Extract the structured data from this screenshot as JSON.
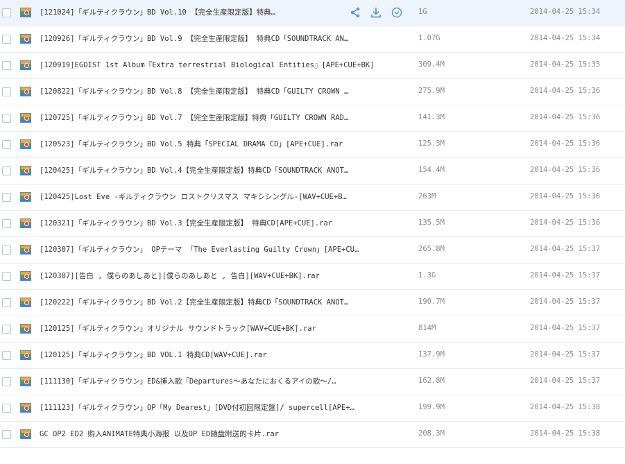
{
  "files": [
    {
      "name": "[121024]「ギルティクラウン」BD Vol.10 【完全生産限定版】特典…",
      "size": "1G",
      "time": "2014-04-25 15:34"
    },
    {
      "name": "[120926]「ギルティクラウン」BD Vol.9 【完全生産限定版】 特典CD「SOUNDTRACK AN…",
      "size": "1.07G",
      "time": "2014-04-25 15:34"
    },
    {
      "name": "[120919]EGOIST 1st Album『Extra terrestrial Biological Entities』[APE+CUE+BK]…",
      "size": "309.4M",
      "time": "2014-04-25 15:35"
    },
    {
      "name": "[120822]「ギルティクラウン」BD Vol.8 【完全生産限定版】 特典CD「GUILTY CROWN …",
      "size": "275.9M",
      "time": "2014-04-25 15:36"
    },
    {
      "name": "[120725]「ギルティクラウン」BD Vol.7 【完全生産限定版】特典「GUILTY CROWN RAD…",
      "size": "141.3M",
      "time": "2014-04-25 15:36"
    },
    {
      "name": "[120523]「ギルティクラウン」BD Vol.5 特典「SPECIAL DRAMA CD」[APE+CUE].rar",
      "size": "125.3M",
      "time": "2014-04-25 15:36"
    },
    {
      "name": "[120425]「ギルティクラウン」BD Vol.4【完全生産限定版】特典CD「SOUNDTRACK ANOT…",
      "size": "154.4M",
      "time": "2014-04-25 15:36"
    },
    {
      "name": "[120425]Lost Eve -ギルティクラウン ロストクリスマス マキシシングル-[WAV+CUE+B…",
      "size": "263M",
      "time": "2014-04-25 15:36"
    },
    {
      "name": "[120321]「ギルティクラウン」BD Vol.3【完全生産限定版】 特典CD[APE+CUE].rar",
      "size": "135.5M",
      "time": "2014-04-25 15:36"
    },
    {
      "name": "[120307]「ギルティクラウン」 OPテーマ 「The Everlasting Guilty Crown」[APE+CU…",
      "size": "265.8M",
      "time": "2014-04-25 15:37"
    },
    {
      "name": "[120307][告白 , 僕らのあしあと][僕らのあしあと , 告白][WAV+CUE+BK].rar",
      "size": "1.3G",
      "time": "2014-04-25 15:37"
    },
    {
      "name": "[120222]「ギルティクラウン」BD Vol.2【完全生産限定版】特典CD「SOUNDTRACK ANOT…",
      "size": "190.7M",
      "time": "2014-04-25 15:37"
    },
    {
      "name": "[120125]「ギルティクラウン」オリジナル サウンドトラック[WAV+CUE+BK].rar",
      "size": "814M",
      "time": "2014-04-25 15:37"
    },
    {
      "name": "[120125]「ギルティクラウン」BD VOL.1 特典CD[WAV+CUE].rar",
      "size": "137.9M",
      "time": "2014-04-25 15:37"
    },
    {
      "name": "[111130]「ギルティクラウン」ED&挿入歌「Departures～あなたにおくるアイの歌～/…",
      "size": "162.8M",
      "time": "2014-04-25 15:37"
    },
    {
      "name": "[111123]「ギルティクラウン」OP「My Dearest」[DVD付初回限定盤]/ supercell[APE+…",
      "size": "199.9M",
      "time": "2014-04-25 15:38"
    },
    {
      "name": "GC OP2 ED2 购入ANIMATE特典小海报 以及OP ED随盘附送的卡片.rar",
      "size": "208.3M",
      "time": "2014-04-25 15:38"
    }
  ],
  "hover_actions": [
    "share-icon",
    "download-icon",
    "more-icon"
  ],
  "colors": {
    "hover_row": "#eef4fb",
    "action_icon": "#5b9bd5",
    "border": "#e6ebf1"
  }
}
